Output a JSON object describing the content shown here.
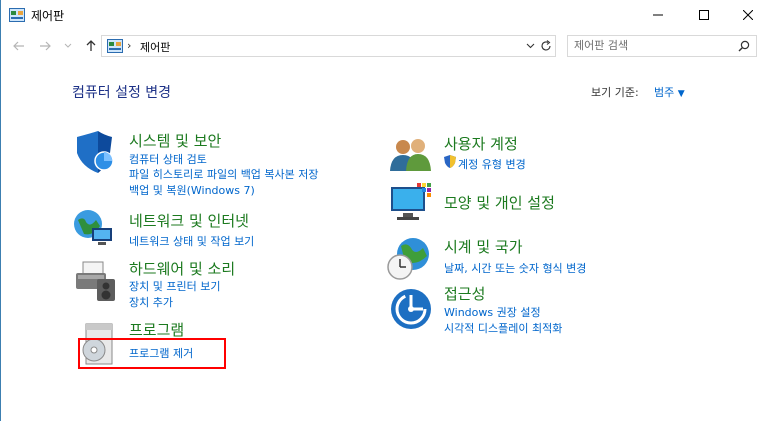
{
  "window": {
    "title": "제어판",
    "minimize_icon": "minimize-icon",
    "maximize_icon": "maximize-icon",
    "close_icon": "close-icon"
  },
  "address_bar": {
    "breadcrumb_sep": "›",
    "breadcrumb": "제어판",
    "search_placeholder": "제어판 검색"
  },
  "header": {
    "title": "컴퓨터 설정 변경",
    "view_by_label": "보기 기준:",
    "view_by_value": "범주"
  },
  "categories": {
    "system": {
      "title": "시스템 및 보안",
      "icon": "shield-icon",
      "links": [
        "컴퓨터 상태 검토",
        "파일 히스토리로 파일의 백업 복사본 저장",
        "백업 및 복원(Windows 7)"
      ]
    },
    "network": {
      "title": "네트워크 및 인터넷",
      "icon": "network-icon",
      "links": [
        "네트워크 상태 및 작업 보기"
      ]
    },
    "hardware": {
      "title": "하드웨어 및 소리",
      "icon": "printer-icon",
      "links": [
        "장치 및 프린터 보기",
        "장치 추가"
      ]
    },
    "programs": {
      "title": "프로그램",
      "icon": "programs-icon",
      "links": [
        "프로그램 제거"
      ]
    },
    "users": {
      "title": "사용자 계정",
      "icon": "users-icon",
      "links": [
        "계정 유형 변경"
      ]
    },
    "appearance": {
      "title": "모양 및 개인 설정",
      "icon": "monitor-icon",
      "links": []
    },
    "clock": {
      "title": "시계 및 국가",
      "icon": "clock-globe-icon",
      "links": [
        "날짜, 시간 또는 숫자 형식 변경"
      ]
    },
    "ease": {
      "title": "접근성",
      "icon": "ease-of-access-icon",
      "links": [
        "Windows 권장 설정",
        "시각적 디스플레이 최적화"
      ]
    }
  },
  "colors": {
    "category_title": "#1c7a1f",
    "link": "#0066cc",
    "heading": "#1e3287",
    "highlight": "#ff0000"
  }
}
